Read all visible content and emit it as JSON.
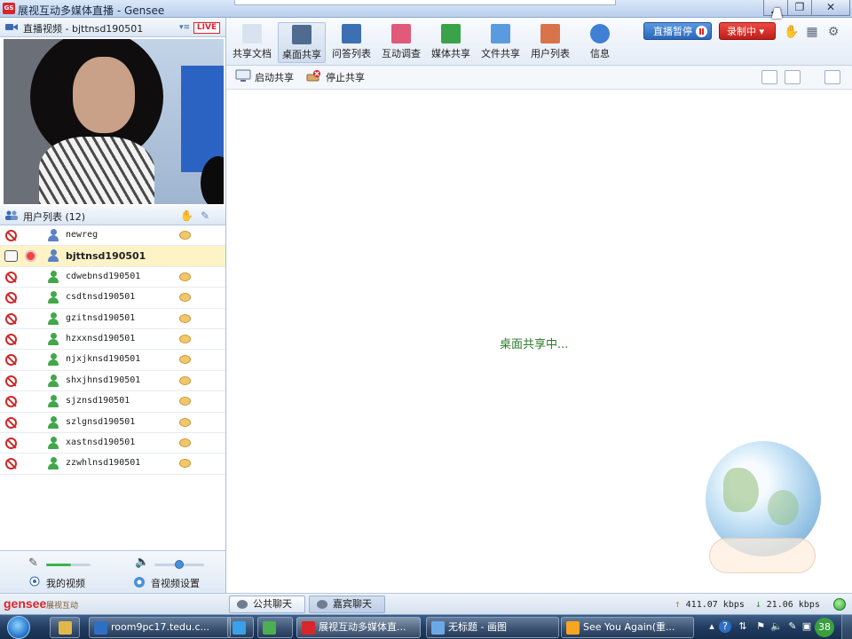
{
  "window": {
    "title": "展视互动多媒体直播 - Gensee",
    "minimize": "▁",
    "maximize": "❐",
    "close": "✕"
  },
  "video": {
    "header_label": "直播视频 - bjttnsd190501",
    "live_badge": "LIVE",
    "camera_ctrl": "▾≡"
  },
  "users": {
    "header_label": "用户列表 (12)",
    "rows": [
      {
        "name": "newreg",
        "mic": "off",
        "camera": false,
        "role": "presenter-pen",
        "chat": true,
        "selected": false
      },
      {
        "name": "bjttnsd190501",
        "mic": "on",
        "camera": true,
        "role": "presenter-pen",
        "chat": false,
        "selected": true
      },
      {
        "name": "cdwebnsd190501",
        "mic": "off",
        "camera": false,
        "role": "attendee",
        "chat": true,
        "selected": false
      },
      {
        "name": "csdtnsd190501",
        "mic": "off",
        "camera": false,
        "role": "attendee",
        "chat": true,
        "selected": false
      },
      {
        "name": "gzitnsd190501",
        "mic": "off",
        "camera": false,
        "role": "attendee",
        "chat": true,
        "selected": false
      },
      {
        "name": "hzxxnsd190501",
        "mic": "off",
        "camera": false,
        "role": "attendee",
        "chat": true,
        "selected": false
      },
      {
        "name": "njxjknsd190501",
        "mic": "off",
        "camera": false,
        "role": "attendee",
        "chat": true,
        "selected": false
      },
      {
        "name": "shxjhnsd190501",
        "mic": "off",
        "camera": false,
        "role": "attendee",
        "chat": true,
        "selected": false
      },
      {
        "name": "sjznsd190501",
        "mic": "off",
        "camera": false,
        "role": "attendee",
        "chat": true,
        "selected": false
      },
      {
        "name": "szlgnsd190501",
        "mic": "off",
        "camera": false,
        "role": "attendee",
        "chat": true,
        "selected": false
      },
      {
        "name": "xastnsd190501",
        "mic": "off",
        "camera": false,
        "role": "attendee",
        "chat": true,
        "selected": false
      },
      {
        "name": "zzwhlnsd190501",
        "mic": "off",
        "camera": false,
        "role": "attendee",
        "chat": true,
        "selected": false
      }
    ]
  },
  "left_bottom": {
    "my_video": "我的视频",
    "av_settings": "音视频设置",
    "mic_level": 0.55,
    "speaker_level": 0.5
  },
  "toolbar": {
    "items": [
      {
        "label": "共享文档",
        "icon": "document-icon",
        "color": "#d9e3ef"
      },
      {
        "label": "桌面共享",
        "icon": "desktop-share-icon",
        "color": "#4f6b8f"
      },
      {
        "label": "问答列表",
        "icon": "qa-list-icon",
        "color": "#3d6fb3"
      },
      {
        "label": "互动调查",
        "icon": "survey-chart-icon",
        "color": "#e05a7a"
      },
      {
        "label": "媒体共享",
        "icon": "media-share-icon",
        "color": "#3aa34a"
      },
      {
        "label": "文件共享",
        "icon": "file-share-icon",
        "color": "#5a9be0"
      },
      {
        "label": "用户列表",
        "icon": "user-list-icon",
        "color": "#d9744a"
      },
      {
        "label": "信息",
        "icon": "info-icon",
        "color": "#3f7fd4"
      }
    ],
    "active_index": 1,
    "pause_label": "直播暂停",
    "record_label": "录制中 ▾"
  },
  "subtoolbar": {
    "start_share": "启动共享",
    "stop_share": "停止共享"
  },
  "main": {
    "status_text": "桌面共享中..."
  },
  "bottom": {
    "logo": "gensee",
    "logo_sub": "展视互动",
    "public_chat": "公共聊天",
    "guest_chat": "嘉宾聊天",
    "upload_rate": "411.07 kbps",
    "download_rate": "21.06 kbps"
  },
  "taskbar": {
    "buttons": [
      {
        "label": "room9pc17.tedu.c...",
        "color": "#2f6fc3"
      },
      {
        "label": "",
        "color": "#3aa0e8"
      },
      {
        "label": "",
        "color": "#4caf50"
      },
      {
        "label": "展视互动多媒体直...",
        "color": "#d8262a"
      },
      {
        "label": "无标题 - 画图",
        "color": "#6aa9e6"
      },
      {
        "label": "See You Again(重...",
        "color": "#f5a623"
      }
    ],
    "badge": "38"
  }
}
